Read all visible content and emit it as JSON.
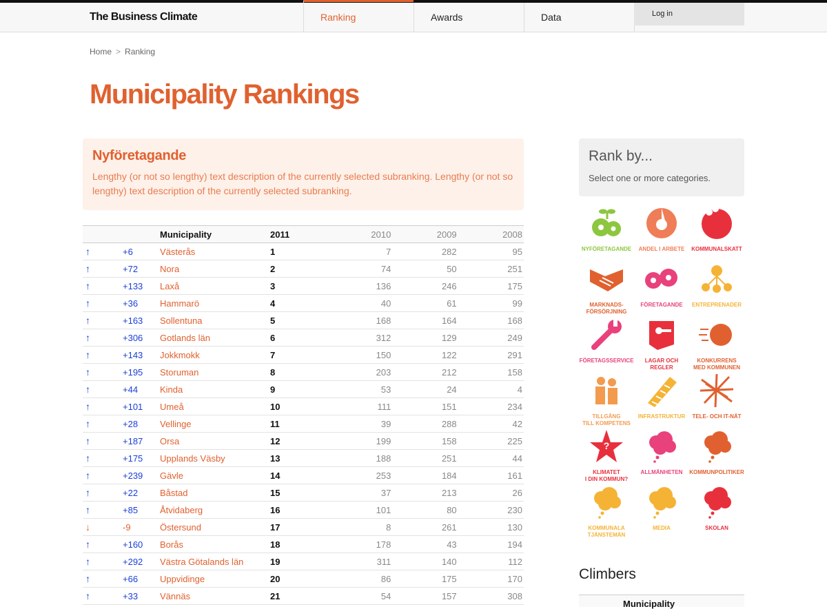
{
  "header": {
    "brand": "The Business Climate",
    "nav": [
      {
        "label": "Ranking",
        "active": true
      },
      {
        "label": "Awards",
        "active": false
      },
      {
        "label": "Data",
        "active": false
      }
    ],
    "login_label": "Log in"
  },
  "breadcrumb": {
    "home": "Home",
    "separator": ">",
    "current": "Ranking"
  },
  "page_title": "Municipality Rankings",
  "subranking": {
    "title": "Nyföretagande",
    "description": "Lengthy (or not so lengthy) text description of the currently selected subranking. Lengthy (or not so lengthy) text description of the currently selected subranking."
  },
  "table": {
    "headers": {
      "municipality": "Municipality",
      "y2011": "2011",
      "y2010": "2010",
      "y2009": "2009",
      "y2008": "2008"
    },
    "rows": [
      {
        "dir": "up",
        "arrow": "↑",
        "change": "+6",
        "name": "Västerås",
        "r2011": "1",
        "r2010": "7",
        "r2009": "282",
        "r2008": "95"
      },
      {
        "dir": "up",
        "arrow": "↑",
        "change": "+72",
        "name": "Nora",
        "r2011": "2",
        "r2010": "74",
        "r2009": "50",
        "r2008": "251"
      },
      {
        "dir": "up",
        "arrow": "↑",
        "change": "+133",
        "name": "Laxå",
        "r2011": "3",
        "r2010": "136",
        "r2009": "246",
        "r2008": "175"
      },
      {
        "dir": "up",
        "arrow": "↑",
        "change": "+36",
        "name": "Hammarö",
        "r2011": "4",
        "r2010": "40",
        "r2009": "61",
        "r2008": "99"
      },
      {
        "dir": "up",
        "arrow": "↑",
        "change": "+163",
        "name": "Sollentuna",
        "r2011": "5",
        "r2010": "168",
        "r2009": "164",
        "r2008": "168"
      },
      {
        "dir": "up",
        "arrow": "↑",
        "change": "+306",
        "name": "Gotlands län",
        "r2011": "6",
        "r2010": "312",
        "r2009": "129",
        "r2008": "249"
      },
      {
        "dir": "up",
        "arrow": "↑",
        "change": "+143",
        "name": "Jokkmokk",
        "r2011": "7",
        "r2010": "150",
        "r2009": "122",
        "r2008": "291"
      },
      {
        "dir": "up",
        "arrow": "↑",
        "change": "+195",
        "name": "Storuman",
        "r2011": "8",
        "r2010": "203",
        "r2009": "212",
        "r2008": "158"
      },
      {
        "dir": "up",
        "arrow": "↑",
        "change": "+44",
        "name": "Kinda",
        "r2011": "9",
        "r2010": "53",
        "r2009": "24",
        "r2008": "4"
      },
      {
        "dir": "up",
        "arrow": "↑",
        "change": "+101",
        "name": "Umeå",
        "r2011": "10",
        "r2010": "111",
        "r2009": "151",
        "r2008": "234"
      },
      {
        "dir": "up",
        "arrow": "↑",
        "change": "+28",
        "name": "Vellinge",
        "r2011": "11",
        "r2010": "39",
        "r2009": "288",
        "r2008": "42"
      },
      {
        "dir": "up",
        "arrow": "↑",
        "change": "+187",
        "name": "Orsa",
        "r2011": "12",
        "r2010": "199",
        "r2009": "158",
        "r2008": "225"
      },
      {
        "dir": "up",
        "arrow": "↑",
        "change": "+175",
        "name": "Upplands Väsby",
        "r2011": "13",
        "r2010": "188",
        "r2009": "251",
        "r2008": "44"
      },
      {
        "dir": "up",
        "arrow": "↑",
        "change": "+239",
        "name": "Gävle",
        "r2011": "14",
        "r2010": "253",
        "r2009": "184",
        "r2008": "161"
      },
      {
        "dir": "up",
        "arrow": "↑",
        "change": "+22",
        "name": "Båstad",
        "r2011": "15",
        "r2010": "37",
        "r2009": "213",
        "r2008": "26"
      },
      {
        "dir": "up",
        "arrow": "↑",
        "change": "+85",
        "name": "Åtvidaberg",
        "r2011": "16",
        "r2010": "101",
        "r2009": "80",
        "r2008": "230"
      },
      {
        "dir": "down",
        "arrow": "↓",
        "change": "-9",
        "name": "Östersund",
        "r2011": "17",
        "r2010": "8",
        "r2009": "261",
        "r2008": "130"
      },
      {
        "dir": "up",
        "arrow": "↑",
        "change": "+160",
        "name": "Borås",
        "r2011": "18",
        "r2010": "178",
        "r2009": "43",
        "r2008": "194"
      },
      {
        "dir": "up",
        "arrow": "↑",
        "change": "+292",
        "name": "Västra Götalands län",
        "r2011": "19",
        "r2010": "311",
        "r2009": "140",
        "r2008": "112"
      },
      {
        "dir": "up",
        "arrow": "↑",
        "change": "+66",
        "name": "Uppvidinge",
        "r2011": "20",
        "r2010": "86",
        "r2009": "175",
        "r2008": "170"
      },
      {
        "dir": "up",
        "arrow": "↑",
        "change": "+33",
        "name": "Vännäs",
        "r2011": "21",
        "r2010": "54",
        "r2009": "157",
        "r2008": "308"
      }
    ]
  },
  "rank_by": {
    "title": "Rank by...",
    "subtitle": "Select one or more categories.",
    "categories": [
      {
        "label": "NYFÖRETAGANDE",
        "icon": "gears-sprout-icon",
        "color": "#8dc63f"
      },
      {
        "label": "ANDEL I ARBETE",
        "icon": "pie-chart-icon",
        "color": "#ef7d58"
      },
      {
        "label": "KOMMUNALSKATT",
        "icon": "bitten-circle-icon",
        "color": "#e8303d"
      },
      {
        "label": "MARKNADS-\nFÖRSÖRJNING",
        "icon": "handshake-icon",
        "color": "#e0612f"
      },
      {
        "label": "FÖRETAGANDE",
        "icon": "gears-icon",
        "color": "#e9417c"
      },
      {
        "label": "ENTREPRENADER",
        "icon": "network-icon",
        "color": "#f5b335"
      },
      {
        "label": "FÖRETAGSSERVICE",
        "icon": "wrench-icon",
        "color": "#e9417c"
      },
      {
        "label": "LAGAR OCH REGLER",
        "icon": "law-book-icon",
        "color": "#e8303d"
      },
      {
        "label": "KONKURRENS\nMED KOMMUNEN",
        "icon": "speed-ball-icon",
        "color": "#e0612f"
      },
      {
        "label": "TILLGÅNG\nTILL KOMPETENS",
        "icon": "people-icon",
        "color": "#f29b4f"
      },
      {
        "label": "INFRASTRUKTUR",
        "icon": "railway-icon",
        "color": "#f5b335"
      },
      {
        "label": "TELE- OCH IT-NÄT",
        "icon": "wire-network-icon",
        "color": "#e0612f"
      },
      {
        "label": "KLIMATET\nI DIN KOMMUN?",
        "icon": "star-question-icon",
        "color": "#e8303d"
      },
      {
        "label": "ALLMÄNHETEN",
        "icon": "cloud-bubble-icon",
        "color": "#e9417c"
      },
      {
        "label": "KOMMUNPOLITIKER",
        "icon": "cloud-bubble-icon",
        "color": "#e0612f"
      },
      {
        "label": "KOMMUNALA\nTJÄNSTEMÄN",
        "icon": "cloud-bubble-icon",
        "color": "#f5b335"
      },
      {
        "label": "MEDIA",
        "icon": "cloud-bubble-icon",
        "color": "#f5b335"
      },
      {
        "label": "SKOLAN",
        "icon": "cloud-bubble-icon",
        "color": "#e8303d"
      }
    ]
  },
  "climbers": {
    "title": "Climbers",
    "header_municipality": "Municipality"
  }
}
